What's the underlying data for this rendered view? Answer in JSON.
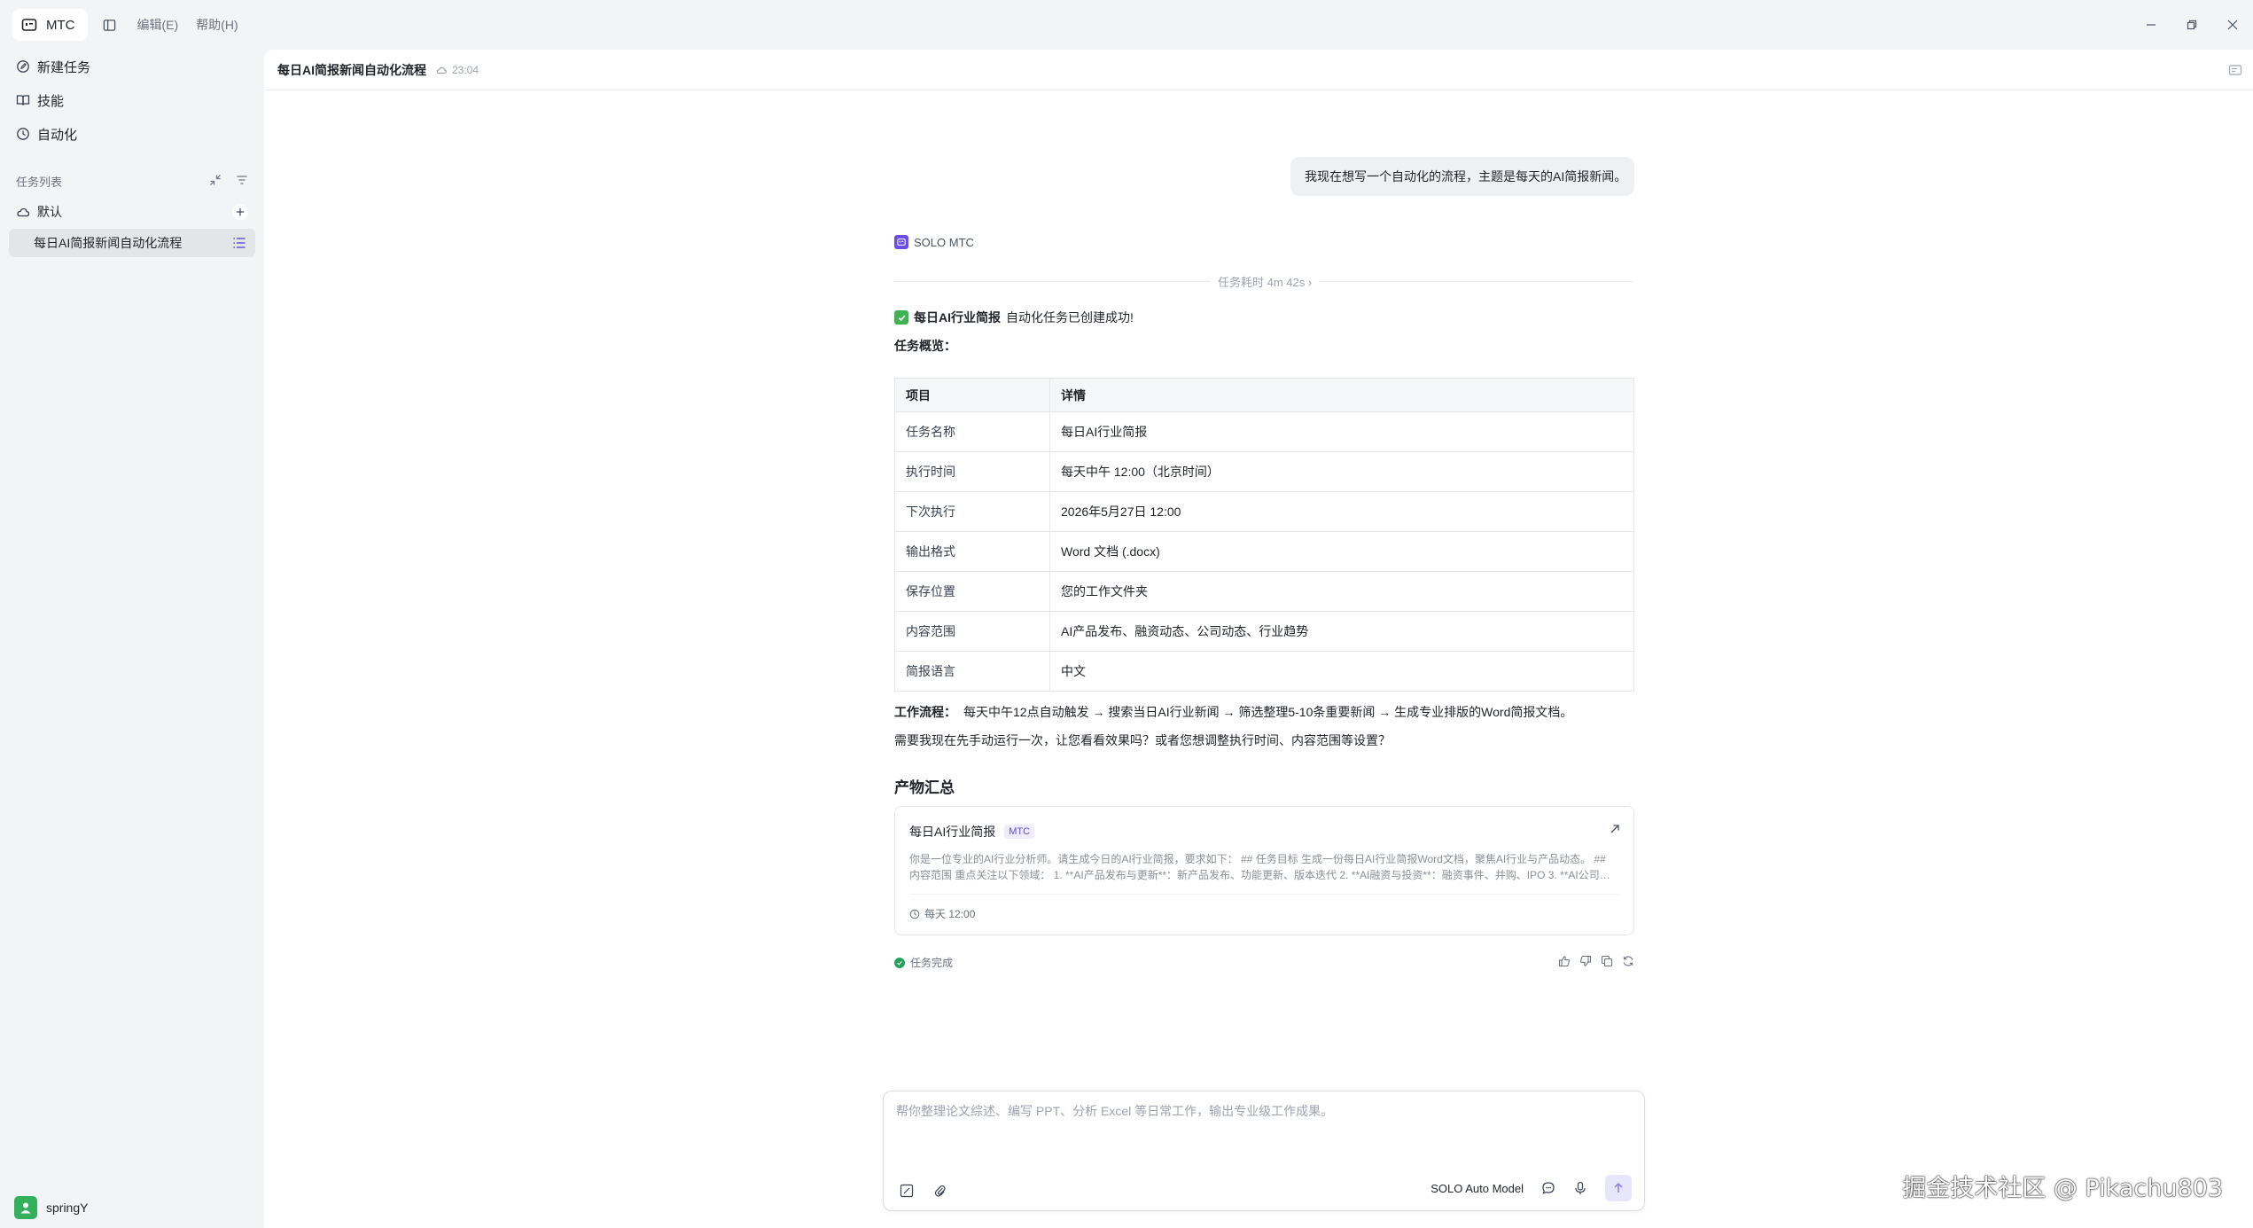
{
  "titlebar": {
    "app_name": "MTC",
    "menus": [
      "编辑(E)",
      "帮助(H)"
    ]
  },
  "sidebar": {
    "nav": [
      {
        "label": "新建任务",
        "icon": "new-task-icon"
      },
      {
        "label": "技能",
        "icon": "book-icon"
      },
      {
        "label": "自动化",
        "icon": "clock-icon"
      }
    ],
    "section_label": "任务列表",
    "group_label": "默认",
    "task_label": "每日AI简报新闻自动化流程",
    "user_name": "springY"
  },
  "main": {
    "title": "每日AI简报新闻自动化流程",
    "time": "23:04",
    "user_message": "我现在想写一个自动化的流程，主题是每天的AI简报新闻。",
    "agent_name": "SOLO MTC",
    "duration": "任务耗时 4m 42s ›",
    "success_bold": "每日AI行业简报",
    "success_rest": "自动化任务已创建成功!",
    "overview_label": "任务概览：",
    "table": {
      "headers": [
        "项目",
        "详情"
      ],
      "rows": [
        [
          "任务名称",
          "每日AI行业简报"
        ],
        [
          "执行时间",
          "每天中午 12:00（北京时间）"
        ],
        [
          "下次执行",
          "2026年5月27日 12:00"
        ],
        [
          "输出格式",
          "Word 文档 (.docx)"
        ],
        [
          "保存位置",
          "您的工作文件夹"
        ],
        [
          "内容范围",
          "AI产品发布、融资动态、公司动态、行业趋势"
        ],
        [
          "简报语言",
          "中文"
        ]
      ]
    },
    "workflow_label": "工作流程：",
    "workflow_text": "每天中午12点自动触发 → 搜索当日AI行业新闻 → 筛选整理5-10条重要新闻 → 生成专业排版的Word简报文档。",
    "followup": "需要我现在先手动运行一次，让您看看效果吗？或者您想调整执行时间、内容范围等设置？",
    "artifact_heading": "产物汇总",
    "artifact": {
      "title": "每日AI行业简报",
      "tag": "MTC",
      "desc": "你是一位专业的AI行业分析师。请生成今日的AI行业简报，要求如下： ## 任务目标 生成一份每日AI行业简报Word文档，聚焦AI行业与产品动态。 ## 内容范围 重点关注以下领域： 1. **AI产品发布与更新**：新产品发布、功能更新、版本迭代 2. **AI融资与投资**：融资事件、并购、IPO 3. **AI公司动态**...",
      "schedule": "每天 12:00"
    },
    "status": "任务完成"
  },
  "composer": {
    "placeholder": "帮你整理论文综述、编写 PPT、分析 Excel 等日常工作，输出专业级工作成果。",
    "model": "SOLO Auto Model"
  },
  "watermark": "掘金技术社区 @ Pikachu803"
}
